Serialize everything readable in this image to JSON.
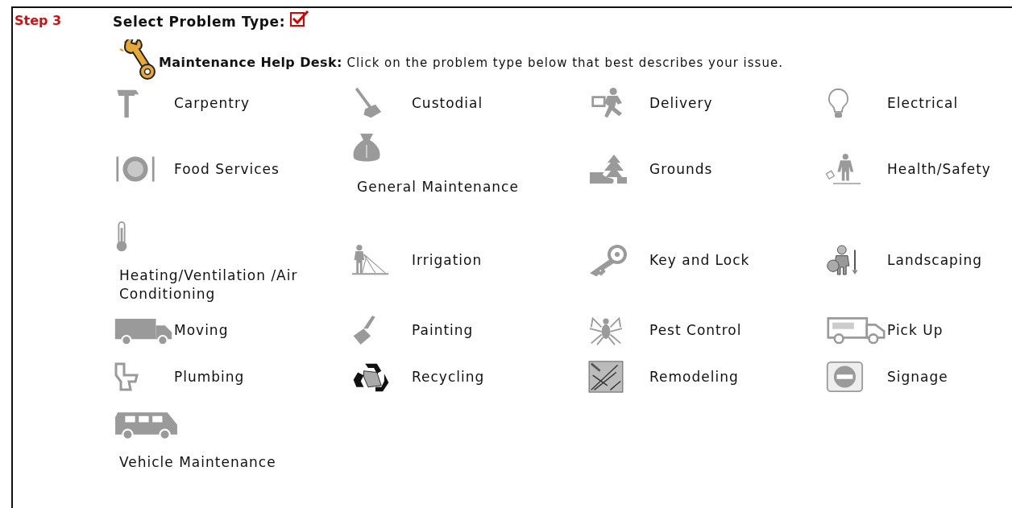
{
  "header": {
    "step": "Step 3",
    "title": "Select Problem Type:"
  },
  "intro": {
    "lead": "Maintenance Help Desk:",
    "text": "Click on the problem type below that best describes your issue."
  },
  "problem_types": [
    {
      "label": "Carpentry",
      "kind": "inline"
    },
    {
      "label": "Custodial",
      "kind": "inline"
    },
    {
      "label": "Delivery",
      "kind": "inline"
    },
    {
      "label": "Electrical",
      "kind": "inline"
    },
    {
      "label": "Food Services",
      "kind": "inline"
    },
    {
      "label": "General Maintenance",
      "kind": "stacked"
    },
    {
      "label": "Grounds",
      "kind": "inline"
    },
    {
      "label": "Health/Safety",
      "kind": "inline"
    },
    {
      "label": "Heating/Ventilation /Air Conditioning",
      "kind": "stacked"
    },
    {
      "label": "Irrigation",
      "kind": "inline"
    },
    {
      "label": "Key and Lock",
      "kind": "inline"
    },
    {
      "label": "Landscaping",
      "kind": "inline"
    },
    {
      "label": "Moving",
      "kind": "inline"
    },
    {
      "label": "Painting",
      "kind": "inline"
    },
    {
      "label": "Pest Control",
      "kind": "inline"
    },
    {
      "label": "Pick Up",
      "kind": "inline"
    },
    {
      "label": "Plumbing",
      "kind": "inline"
    },
    {
      "label": "Recycling",
      "kind": "inline"
    },
    {
      "label": "Remodeling",
      "kind": "inline"
    },
    {
      "label": "Signage",
      "kind": "inline"
    },
    {
      "label": "Vehicle Maintenance",
      "kind": "stacked"
    }
  ]
}
